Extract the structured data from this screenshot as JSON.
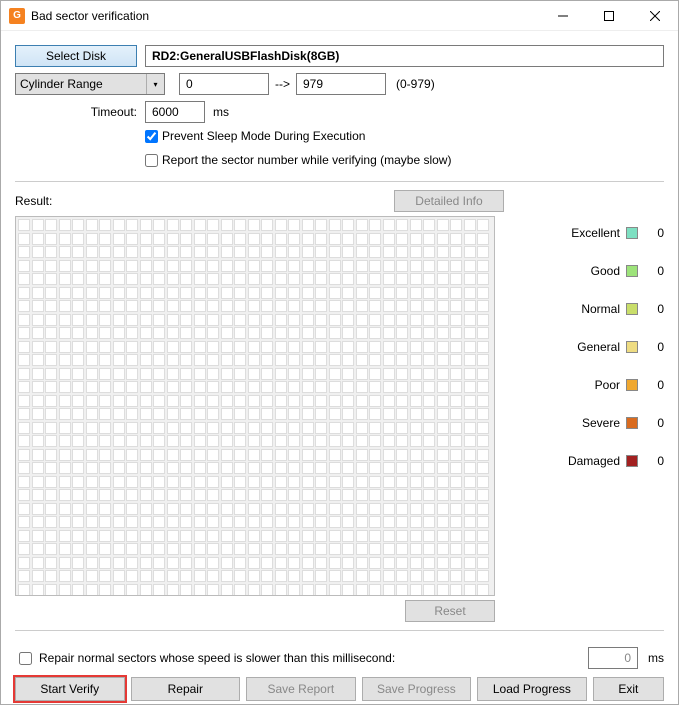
{
  "window": {
    "title": "Bad sector verification",
    "icon_text": "G"
  },
  "select_disk": {
    "button": "Select Disk",
    "value": "RD2:GeneralUSBFlashDisk(8GB)"
  },
  "cylinder": {
    "label": "Cylinder Range",
    "from": "0",
    "to": "979",
    "hint": "(0-979)"
  },
  "timeout": {
    "label": "Timeout:",
    "value": "6000",
    "unit": "ms"
  },
  "options": {
    "prevent_sleep": {
      "label": "Prevent Sleep Mode During Execution",
      "checked": true
    },
    "report_sector": {
      "label": "Report the sector number while verifying (maybe slow)",
      "checked": false
    }
  },
  "result_label": "Result:",
  "detailed_info": "Detailed Info",
  "legend": [
    {
      "name": "Excellent",
      "color": "#7ee0c2",
      "count": 0
    },
    {
      "name": "Good",
      "color": "#9de37a",
      "count": 0
    },
    {
      "name": "Normal",
      "color": "#c9de6a",
      "count": 0
    },
    {
      "name": "General",
      "color": "#eedc82",
      "count": 0
    },
    {
      "name": "Poor",
      "color": "#f0a830",
      "count": 0
    },
    {
      "name": "Severe",
      "color": "#d96b1f",
      "count": 0
    },
    {
      "name": "Damaged",
      "color": "#a22020",
      "count": 0
    }
  ],
  "reset": "Reset",
  "repair_slow": {
    "label": "Repair normal sectors whose speed is slower than this millisecond:",
    "value": "0",
    "unit": "ms",
    "checked": false
  },
  "buttons": {
    "start": "Start Verify",
    "repair": "Repair",
    "save_report": "Save Report",
    "save_progress": "Save Progress",
    "load_progress": "Load Progress",
    "exit": "Exit"
  }
}
